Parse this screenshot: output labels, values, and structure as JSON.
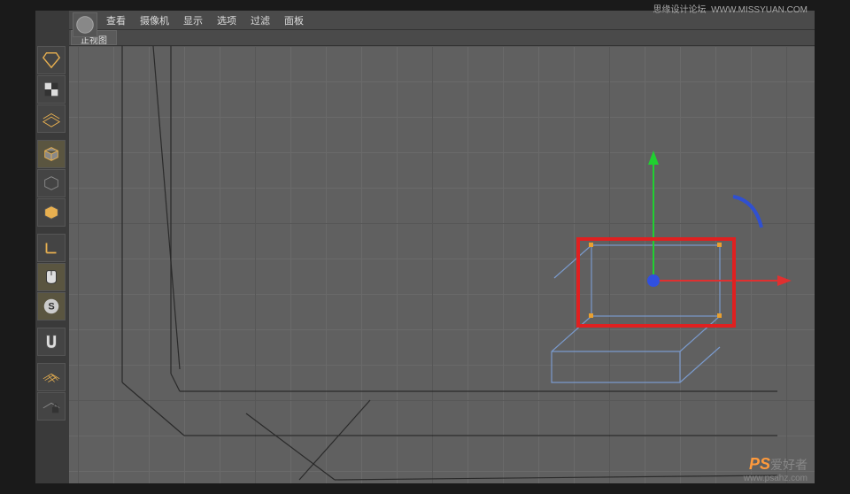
{
  "watermark": {
    "top_left": "思缘设计论坛",
    "top_right": "WWW.MISSYUAN.COM",
    "logo_main": "PS",
    "logo_sub": "爱好者",
    "url": "www.psahz.com"
  },
  "menu": {
    "items": [
      "查看",
      "摄像机",
      "显示",
      "选项",
      "过滤",
      "面板"
    ]
  },
  "tab": {
    "label": "正视图"
  },
  "tools": {
    "t0": "live-select",
    "t1": "texture",
    "t2": "workplane",
    "t3": "model",
    "t4": "object",
    "t5": "render",
    "t6": "axis",
    "t7": "mouse",
    "t8": "snap-s",
    "t9": "magnet",
    "t10": "grid",
    "t11": "lock"
  }
}
